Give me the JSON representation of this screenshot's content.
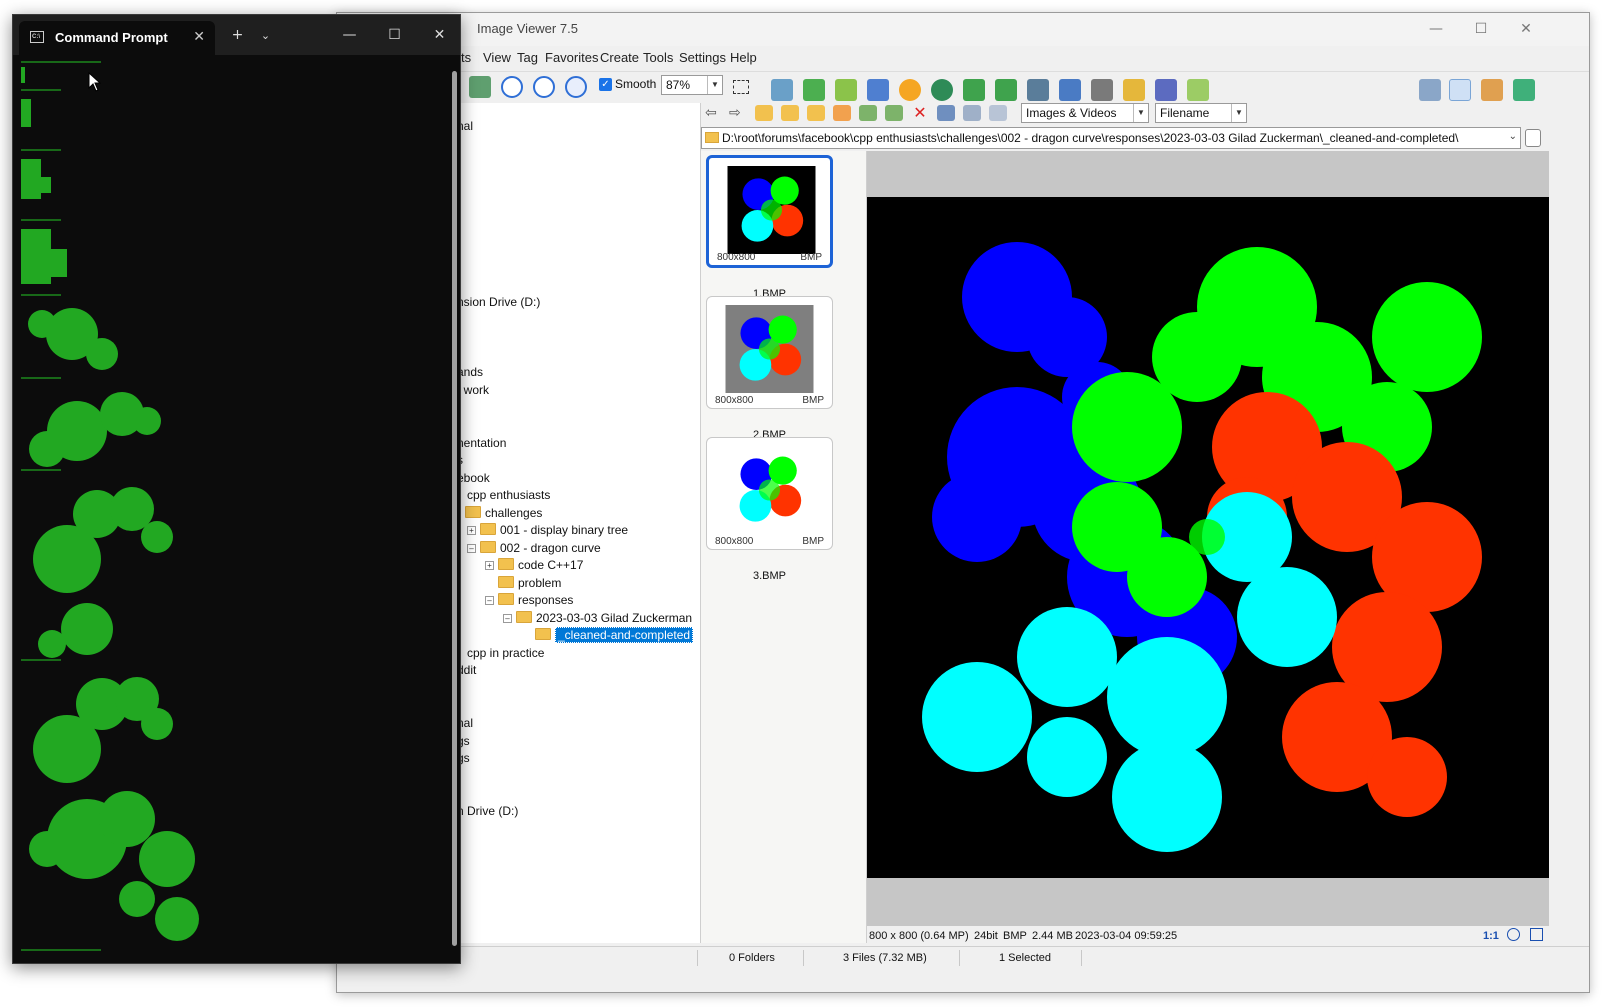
{
  "viewer": {
    "title": "Image Viewer 7.5",
    "menu": [
      "ts",
      "View",
      "Tag",
      "Favorites",
      "Create",
      "Tools",
      "Settings",
      "Help"
    ],
    "smooth_label": "Smooth",
    "zoom": "87%",
    "filter": "Images & Videos",
    "sort": "Filename",
    "path": "D:\\root\\forums\\facebook\\cpp enthusiasts\\challenges\\002 - dragon curve\\responses\\2023-03-03 Gilad Zuckerman\\_cleaned-and-completed\\",
    "tree": [
      "nal",
      ")",
      "nsion Drive (D:)",
      "ands",
      "t work",
      "nentation",
      "s",
      "ebook",
      "cpp enthusiasts",
      "challenges",
      "001 - display binary tree",
      "002 - dragon curve",
      "code C++17",
      "problem",
      "responses",
      "2023-03-03 Gilad Zuckerman",
      "_cleaned-and-completed",
      "cpp in practice",
      "ddit",
      "nal",
      "gs",
      "gs",
      "n Drive (D:)"
    ],
    "thumbnails": [
      {
        "name": "1.BMP",
        "dims": "800x800",
        "format": "BMP"
      },
      {
        "name": "2.BMP",
        "dims": "800x800",
        "format": "BMP"
      },
      {
        "name": "3.BMP",
        "dims": "800x800",
        "format": "BMP"
      }
    ],
    "info": {
      "dims": "800 x 800 (0.64 MP)",
      "depth": "24bit",
      "format": "BMP",
      "size": "2.44 MB",
      "date": "2023-03-04 09:59:25",
      "ratio": "1:1"
    },
    "status": {
      "folders": "0 Folders",
      "files": "3 Files (7.32 MB)",
      "selected": "1 Selected"
    }
  },
  "cmd": {
    "tab_title": "Command Prompt"
  },
  "colors": {
    "blue": "#0000ff",
    "green": "#00ff00",
    "red": "#ff3300",
    "cyan": "#00ffff",
    "console_green": "#22a822",
    "selection": "#0078d7"
  }
}
